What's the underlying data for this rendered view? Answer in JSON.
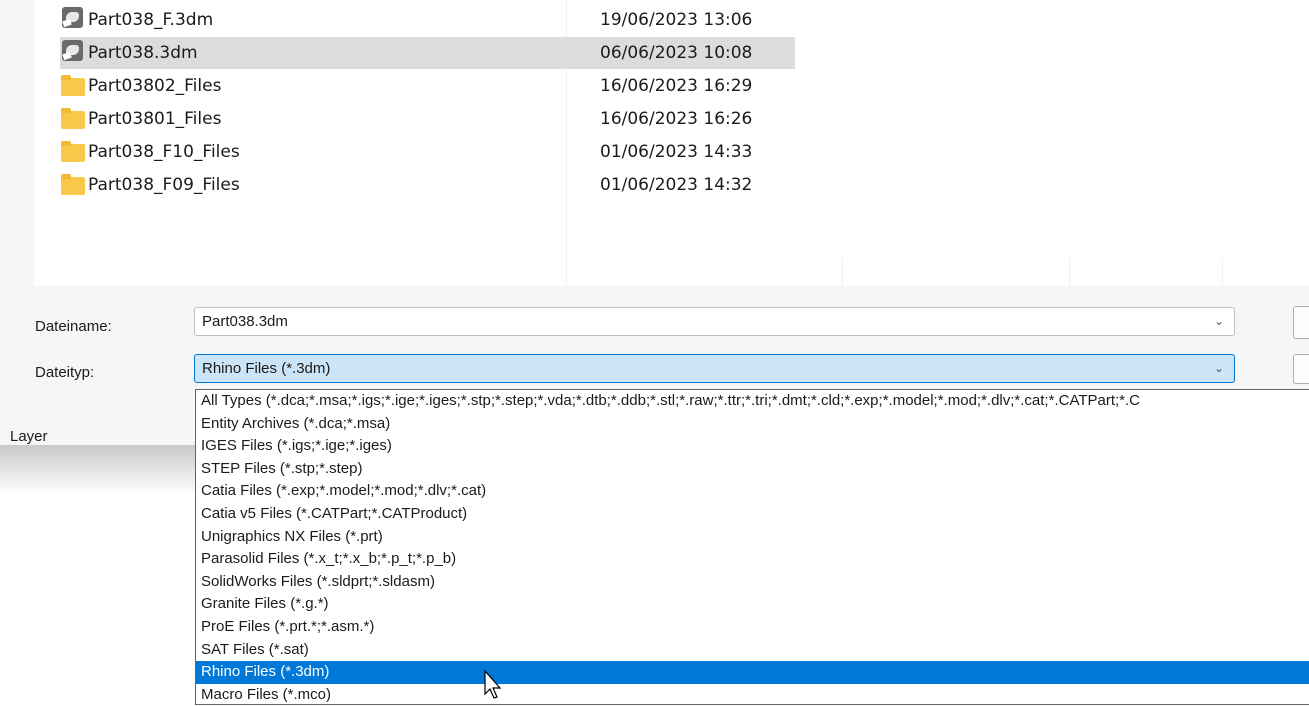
{
  "files": [
    {
      "name": "Part038_F.3dm",
      "date": "19/06/2023 13:06",
      "icon": "rhino-file-icon",
      "selected": false
    },
    {
      "name": "Part038.3dm",
      "date": "06/06/2023 10:08",
      "icon": "rhino-file-icon",
      "selected": true
    },
    {
      "name": "Part03802_Files",
      "date": "16/06/2023 16:29",
      "icon": "folder-icon",
      "selected": false
    },
    {
      "name": "Part03801_Files",
      "date": "16/06/2023 16:26",
      "icon": "folder-icon",
      "selected": false
    },
    {
      "name": "Part038_F10_Files",
      "date": "01/06/2023 14:33",
      "icon": "folder-icon",
      "selected": false
    },
    {
      "name": "Part038_F09_Files",
      "date": "01/06/2023 14:32",
      "icon": "folder-icon",
      "selected": false
    }
  ],
  "filename": {
    "label": "Dateiname:",
    "value": "Part038.3dm"
  },
  "filetype": {
    "label": "Dateityp:",
    "value": "Rhino Files (*.3dm)",
    "options": [
      "All Types (*.dca;*.msa;*.igs;*.ige;*.iges;*.stp;*.step;*.vda;*.dtb;*.ddb;*.stl;*.raw;*.ttr;*.tri;*.dmt;*.cld;*.exp;*.model;*.mod;*.dlv;*.cat;*.CATPart;*.C",
      "Entity Archives (*.dca;*.msa)",
      "IGES Files (*.igs;*.ige;*.iges)",
      "STEP Files (*.stp;*.step)",
      "Catia Files (*.exp;*.model;*.mod;*.dlv;*.cat)",
      "Catia v5 Files (*.CATPart;*.CATProduct)",
      "Unigraphics NX Files (*.prt)",
      "Parasolid Files (*.x_t;*.x_b;*.p_t;*.p_b)",
      "SolidWorks Files (*.sldprt;*.sldasm)",
      "Granite Files (*.g.*)",
      "ProE Files (*.prt.*;*.asm.*)",
      "SAT Files (*.sat)",
      "Rhino Files (*.3dm)",
      "Macro Files (*.mco)"
    ],
    "selected_index": 12
  },
  "layer_label": "Layer",
  "chevron_icon": "chevron-down-icon",
  "colors": {
    "selection": "#0078d7",
    "field_focus_bg": "#cce4f7",
    "row_selected": "#dcdcdc"
  }
}
